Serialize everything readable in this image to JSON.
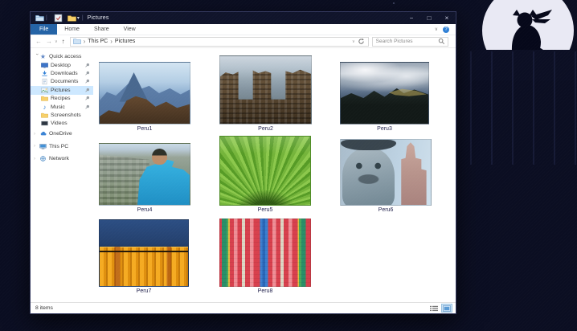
{
  "window": {
    "title": "Pictures",
    "titlebar_icons": [
      "explorer-icon",
      "properties-icon",
      "new-folder-icon",
      "qat-dropdown-icon"
    ],
    "controls": {
      "minimize": "−",
      "maximize": "□",
      "close": "×"
    }
  },
  "ribbon": {
    "tabs": [
      {
        "label": "File",
        "active": true
      },
      {
        "label": "Home",
        "active": false
      },
      {
        "label": "Share",
        "active": false
      },
      {
        "label": "View",
        "active": false
      }
    ],
    "expand_chevron": "∨",
    "help_label": "?"
  },
  "navigation": {
    "back": "←",
    "forward": "→",
    "recent_dropdown": "∨",
    "up": "↑",
    "breadcrumb": [
      "This PC",
      "Pictures"
    ],
    "breadcrumb_separator": "›",
    "address_dropdown": "∨",
    "search_placeholder": "Search Pictures"
  },
  "sidebar": {
    "items": [
      {
        "label": "Quick access",
        "icon": "star-icon",
        "chevron": "expanded",
        "header": true
      },
      {
        "label": "Desktop",
        "icon": "desktop-icon",
        "pinned": true
      },
      {
        "label": "Downloads",
        "icon": "downloads-icon",
        "pinned": true
      },
      {
        "label": "Documents",
        "icon": "documents-icon",
        "pinned": true
      },
      {
        "label": "Pictures",
        "icon": "pictures-icon",
        "pinned": true,
        "selected": true
      },
      {
        "label": "Recipes",
        "icon": "folder-icon",
        "pinned": true
      },
      {
        "label": "Music",
        "icon": "music-icon",
        "pinned": true
      },
      {
        "label": "Screenshots",
        "icon": "folder-icon"
      },
      {
        "label": "Videos",
        "icon": "videos-icon"
      },
      {
        "label": "OneDrive",
        "icon": "onedrive-icon",
        "chevron": "collapsed",
        "root": true
      },
      {
        "label": "This PC",
        "icon": "this-pc-icon",
        "chevron": "collapsed",
        "root": true
      },
      {
        "label": "Network",
        "icon": "network-icon",
        "chevron": "collapsed",
        "root": true
      }
    ]
  },
  "files": [
    {
      "name": "Peru1",
      "art": "peru1"
    },
    {
      "name": "Peru2",
      "art": "peru2"
    },
    {
      "name": "Peru3",
      "art": "peru3"
    },
    {
      "name": "Peru4",
      "art": "peru4"
    },
    {
      "name": "Peru5",
      "art": "peru5"
    },
    {
      "name": "Peru6",
      "art": "peru6"
    },
    {
      "name": "Peru7",
      "art": "peru7"
    },
    {
      "name": "Peru8",
      "art": "peru8"
    }
  ],
  "status_bar": {
    "items_count": "8 items"
  },
  "colors": {
    "desktop_background": "#0b0e22",
    "titlebar": "#10142b",
    "active_tab": "#2463a6",
    "selection": "#cde8ff",
    "moon": "#e9e9f4"
  }
}
